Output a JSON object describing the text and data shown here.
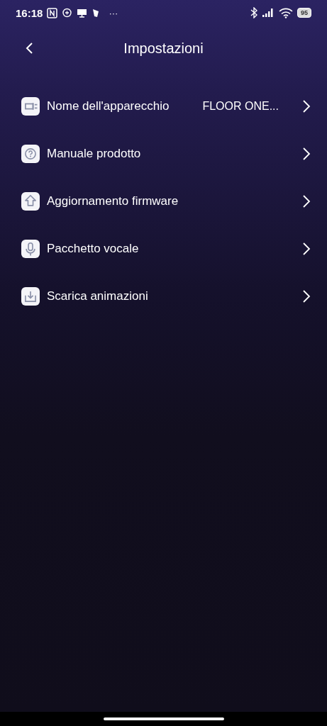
{
  "status_bar": {
    "time": "16:18",
    "more": "···",
    "battery": "95"
  },
  "header": {
    "title": "Impostazioni"
  },
  "items": [
    {
      "kind": "device",
      "label": "Nome dell'apparecchio",
      "value": "FLOOR ONE..."
    },
    {
      "kind": "help",
      "label": "Manuale prodotto"
    },
    {
      "kind": "update",
      "label": "Aggiornamento firmware"
    },
    {
      "kind": "voice",
      "label": "Pacchetto vocale"
    },
    {
      "kind": "download",
      "label": "Scarica animazioni"
    }
  ]
}
